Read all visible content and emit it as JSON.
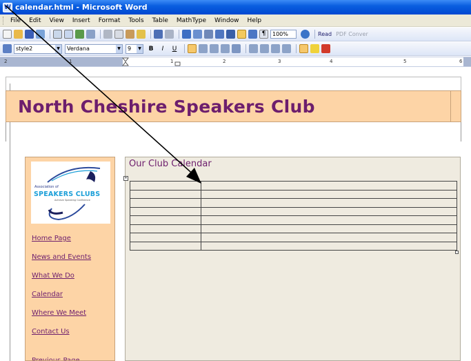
{
  "window": {
    "title": "calendar.html - Microsoft Word"
  },
  "menu": [
    "File",
    "Edit",
    "View",
    "Insert",
    "Format",
    "Tools",
    "Table",
    "MathType",
    "Window",
    "Help"
  ],
  "standard_toolbar": {
    "zoom": "100%",
    "read_label": "Read",
    "pdf_label": "PDF Conver"
  },
  "format_toolbar": {
    "style": "style2",
    "font": "Verdana",
    "size": "9",
    "bold": "B",
    "italic": "I",
    "underline": "U"
  },
  "ruler": {
    "marks": [
      "2",
      "1",
      "1",
      "2",
      "3",
      "4",
      "5",
      "6"
    ]
  },
  "page": {
    "site_title": "North Cheshire Speakers Club",
    "content_title": "Our Club Calendar",
    "logo": {
      "top_text": "Association of",
      "main_text": "SPEAKERS CLUBS",
      "tagline": "Achieve Speaking Confidence"
    },
    "nav": [
      "Home Page",
      "News and Events",
      "What We Do",
      "Calendar",
      "Where We Meet",
      "Contact Us"
    ],
    "nav_cut": "Previous Page"
  },
  "colors": {
    "title_purple": "#6d1e6d",
    "peach": "#fdd4a6",
    "content_bg": "#efebe0",
    "titlebar_blue": "#0a5fe0"
  }
}
